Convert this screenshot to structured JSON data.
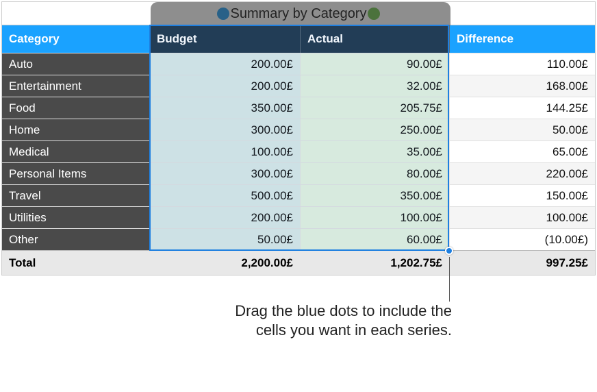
{
  "title": "Summary by Category",
  "series_markers": {
    "blue": "budget",
    "green": "actual"
  },
  "columns": {
    "category": "Category",
    "budget": "Budget",
    "actual": "Actual",
    "difference": "Difference"
  },
  "rows": [
    {
      "category": "Auto",
      "budget": "200.00£",
      "actual": "90.00£",
      "difference": "110.00£"
    },
    {
      "category": "Entertainment",
      "budget": "200.00£",
      "actual": "32.00£",
      "difference": "168.00£"
    },
    {
      "category": "Food",
      "budget": "350.00£",
      "actual": "205.75£",
      "difference": "144.25£"
    },
    {
      "category": "Home",
      "budget": "300.00£",
      "actual": "250.00£",
      "difference": "50.00£"
    },
    {
      "category": "Medical",
      "budget": "100.00£",
      "actual": "35.00£",
      "difference": "65.00£"
    },
    {
      "category": "Personal Items",
      "budget": "300.00£",
      "actual": "80.00£",
      "difference": "220.00£"
    },
    {
      "category": "Travel",
      "budget": "500.00£",
      "actual": "350.00£",
      "difference": "150.00£"
    },
    {
      "category": "Utilities",
      "budget": "200.00£",
      "actual": "100.00£",
      "difference": "100.00£"
    },
    {
      "category": "Other",
      "budget": "50.00£",
      "actual": "60.00£",
      "difference": "(10.00£)",
      "neg": true
    }
  ],
  "total": {
    "label": "Total",
    "budget": "2,200.00£",
    "actual": "1,202.75£",
    "difference": "997.25£"
  },
  "callout": "Drag the blue dots to include the cells you want in each series.",
  "chart_data": {
    "type": "table",
    "title": "Summary by Category",
    "columns": [
      "Category",
      "Budget",
      "Actual",
      "Difference"
    ],
    "currency": "GBP",
    "rows": [
      [
        "Auto",
        200.0,
        90.0,
        110.0
      ],
      [
        "Entertainment",
        200.0,
        32.0,
        168.0
      ],
      [
        "Food",
        350.0,
        205.75,
        144.25
      ],
      [
        "Home",
        300.0,
        250.0,
        50.0
      ],
      [
        "Medical",
        100.0,
        35.0,
        65.0
      ],
      [
        "Personal Items",
        300.0,
        80.0,
        220.0
      ],
      [
        "Travel",
        500.0,
        350.0,
        150.0
      ],
      [
        "Utilities",
        200.0,
        100.0,
        100.0
      ],
      [
        "Other",
        50.0,
        60.0,
        -10.0
      ]
    ],
    "totals": {
      "Budget": 2200.0,
      "Actual": 1202.75,
      "Difference": 997.25
    },
    "series_selection": {
      "columns": [
        "Budget",
        "Actual"
      ],
      "color_map": {
        "Budget": "#1e9cf2",
        "Actual": "#6cc24a"
      }
    }
  }
}
